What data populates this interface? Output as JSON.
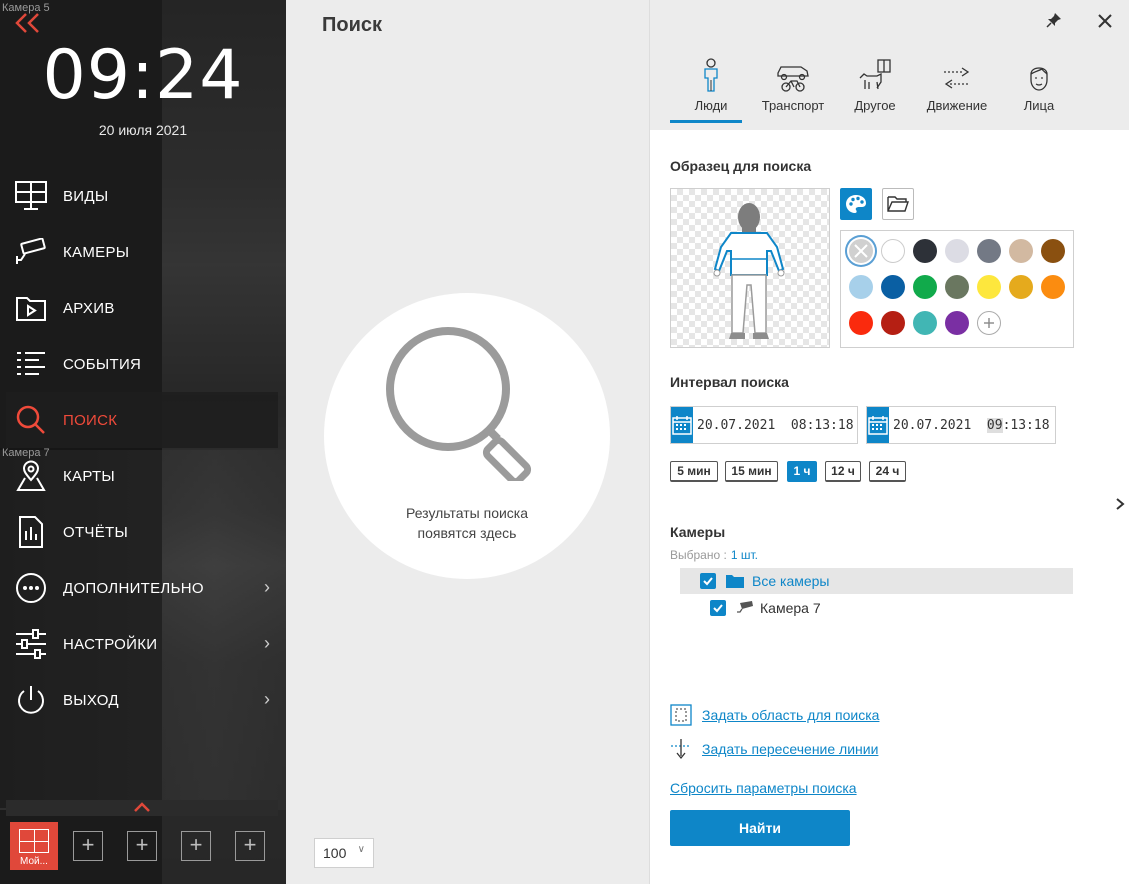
{
  "sidebar": {
    "camera_labels": [
      "Камера 5",
      "Камера 7"
    ],
    "clock": "09:24",
    "date": "20 июля 2021",
    "items": [
      {
        "label": "ВИДЫ",
        "icon": "monitor-grid-icon"
      },
      {
        "label": "КАМЕРЫ",
        "icon": "cctv-camera-icon"
      },
      {
        "label": "АРХИВ",
        "icon": "archive-play-icon"
      },
      {
        "label": "СОБЫТИЯ",
        "icon": "event-list-icon"
      },
      {
        "label": "ПОИСК",
        "icon": "search-icon",
        "active": true
      },
      {
        "label": "КАРТЫ",
        "icon": "map-pin-icon"
      },
      {
        "label": "ОТЧЁТЫ",
        "icon": "report-icon"
      },
      {
        "label": "ДОПОЛНИТЕЛЬНО",
        "icon": "more-dots-icon",
        "has_arrow": true
      },
      {
        "label": "НАСТРОЙКИ",
        "icon": "sliders-icon",
        "has_arrow": true
      },
      {
        "label": "ВЫХОД",
        "icon": "power-icon",
        "has_arrow": true
      }
    ],
    "layout_active_label": "Мой..."
  },
  "search_panel": {
    "title": "Поиск",
    "empty_line1": "Результаты поиска",
    "empty_line2": "появятся здесь",
    "page_size": "100"
  },
  "filters": {
    "tabs": [
      {
        "label": "Люди",
        "icon": "person-icon",
        "active": true
      },
      {
        "label": "Транспорт",
        "icon": "vehicle-icon"
      },
      {
        "label": "Другое",
        "icon": "other-objects-icon"
      },
      {
        "label": "Движение",
        "icon": "motion-arrows-icon"
      },
      {
        "label": "Лица",
        "icon": "face-icon"
      }
    ],
    "sample_title": "Образец для поиска",
    "colors": [
      "#d0d0d0",
      "#ffffff",
      "#2d3138",
      "#dcdce4",
      "#737985",
      "#d2b9a1",
      "#8a5010",
      "#a7d0ea",
      "#0a5fa3",
      "#11aa4b",
      "#6a7760",
      "#fde73d",
      "#e5aa1d",
      "#fb8c10",
      "#fa2a0d",
      "#b51f13",
      "#41b6b4",
      "#7a2fa3"
    ],
    "interval_title": "Интервал поиска",
    "date_from": "20.07.2021  08:13:18",
    "date_to_prefix": "20.07.2021  ",
    "date_to_hour": "09",
    "date_to_suffix": ":13:18",
    "quick_ranges": [
      {
        "label": "5 мин"
      },
      {
        "label": "15 мин"
      },
      {
        "label": "1 ч",
        "active": true
      },
      {
        "label": "12 ч"
      },
      {
        "label": "24 ч"
      }
    ],
    "cameras_title": "Камеры",
    "selected_label": "Выбрано :",
    "selected_count": "1 шт.",
    "all_cameras": "Все камеры",
    "camera_item": "Камера 7",
    "set_area_link": "Задать область для поиска",
    "set_line_link": "Задать пересечение линии",
    "reset_link": "Сбросить параметры поиска",
    "find_button": "Найти"
  }
}
